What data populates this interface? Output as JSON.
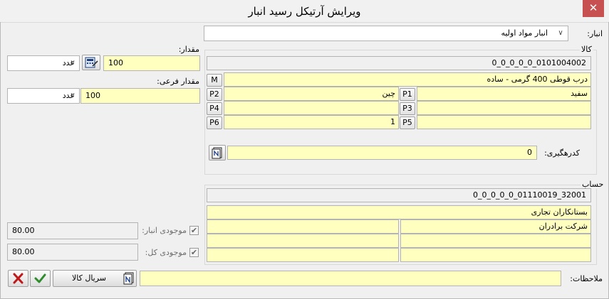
{
  "window": {
    "title": "ویرایش آرتیکل رسید انبار",
    "close_glyph": "✕"
  },
  "warehouse": {
    "label": "انبار:",
    "value": "انبار مواد اولیه"
  },
  "item": {
    "group_title": "کالا",
    "code": "0_0_0_0_0_0101004002",
    "name": "درب قوطی 400 گرمی - ساده",
    "m_label": "M",
    "p1": {
      "label": "P1",
      "value": "سفید"
    },
    "p2": {
      "label": "P2",
      "value": "چین"
    },
    "p3": {
      "label": "P3",
      "value": ""
    },
    "p4": {
      "label": "P4",
      "value": ""
    },
    "p5": {
      "label": "P5",
      "value": ""
    },
    "p6": {
      "label": "P6",
      "value": "1"
    },
    "tracking_label": "کدرهگیری:",
    "tracking_value": "0"
  },
  "quantity": {
    "label": "مقدار:",
    "value": "100",
    "unit": "عدد"
  },
  "sub_quantity": {
    "label": "مقدار فرعی:",
    "value": "100",
    "unit": "عدد"
  },
  "account": {
    "group_title": "حساب",
    "code": "0_0_0_0_0_01110019_32001",
    "name": "بستانکاران تجاری",
    "detail_1": "شرکت برادران",
    "detail_2": "",
    "detail_3": "",
    "detail_4": "",
    "detail_5": "",
    "detail_6": ""
  },
  "stock": {
    "warehouse_label": "موجودی انبار:",
    "warehouse_value": "80.00",
    "total_label": "موجودی کل:",
    "total_value": "80.00",
    "checked": true
  },
  "notes": {
    "label": "ملاحظات:",
    "value": ""
  },
  "footer": {
    "serial_button_label": "سریال کالا"
  },
  "colors": {
    "field_yellow": "#ffffc0",
    "close_red": "#c75050",
    "ok_green": "#2e8b2e",
    "cancel_red": "#c01818"
  }
}
